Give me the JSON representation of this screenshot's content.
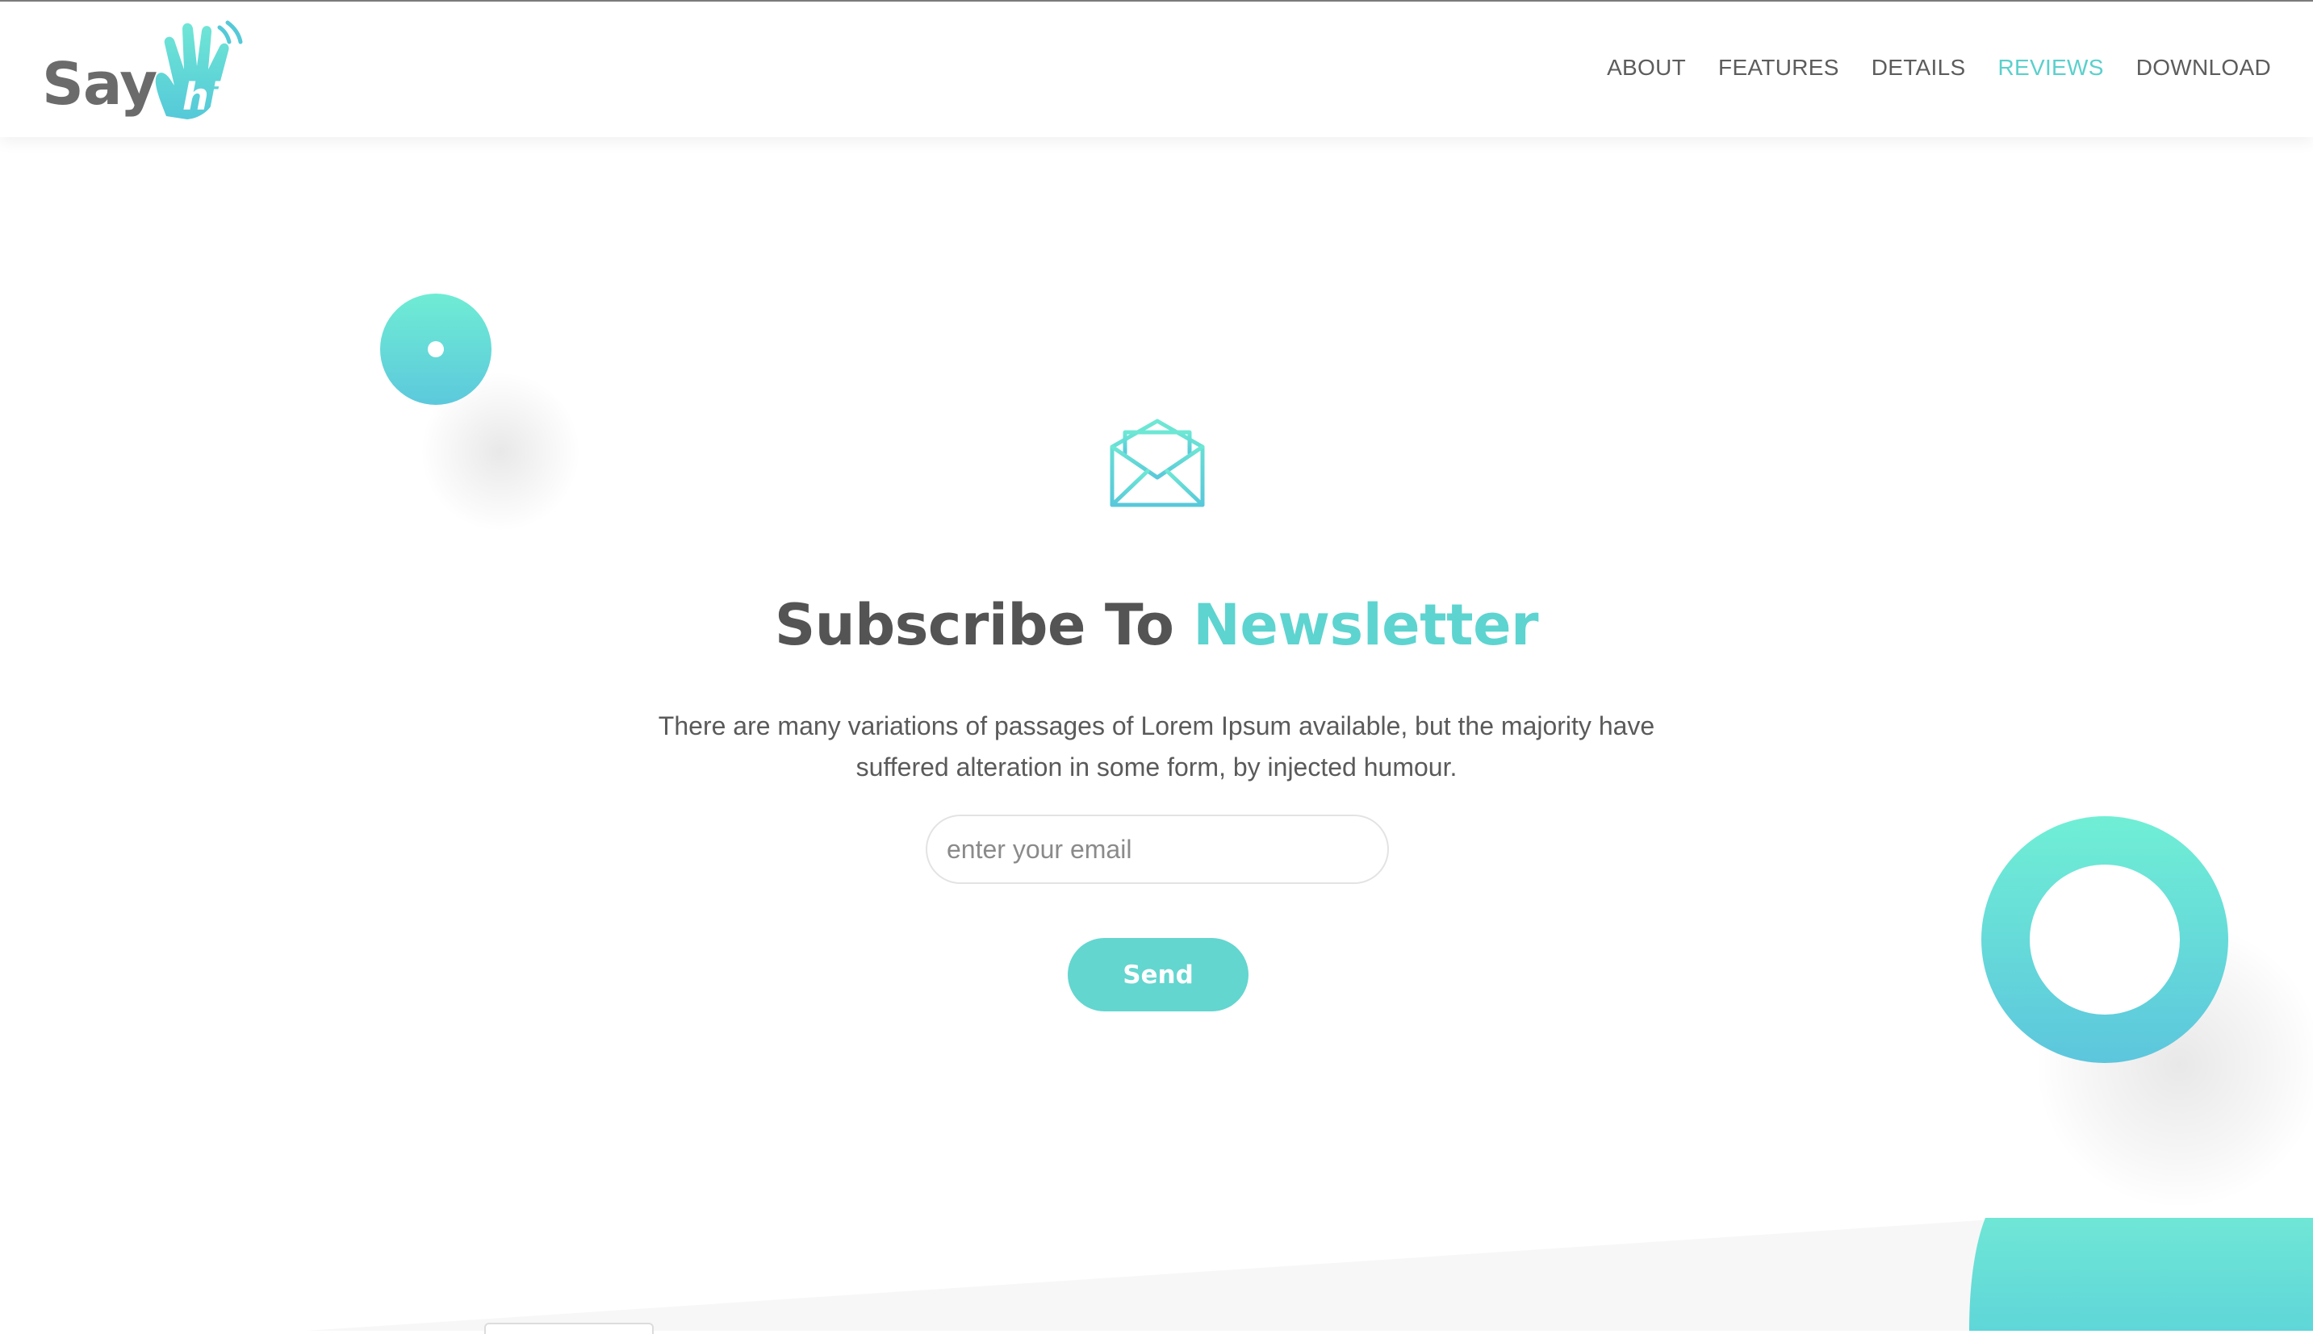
{
  "brand": {
    "name_say": "Say",
    "name_hi": "hi",
    "logo_icon": "waving-hand-icon",
    "accent_color": "#5dd4d0",
    "text_color": "#545454"
  },
  "nav": {
    "items": [
      {
        "label": "ABOUT",
        "active": false
      },
      {
        "label": "FEATURES",
        "active": false
      },
      {
        "label": "DETAILS",
        "active": false
      },
      {
        "label": "REVIEWS",
        "active": true
      },
      {
        "label": "DOWNLOAD",
        "active": false
      }
    ]
  },
  "newsletter": {
    "icon": "envelope-icon",
    "title_lead": "Subscribe To ",
    "title_accent": "Newsletter",
    "description": "There are many variations of passages of Lorem Ipsum available, but the majority have suffered alteration in some form, by injected humour.",
    "email_placeholder": "enter your email",
    "email_value": "",
    "send_label": "Send"
  }
}
